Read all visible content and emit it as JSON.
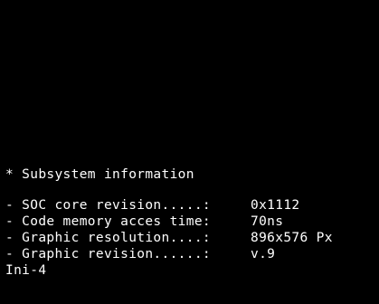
{
  "console": {
    "heading": "* Subsystem information",
    "info": [
      {
        "label": "- SOC core revision.....:",
        "value": "0x1112"
      },
      {
        "label": "- Code memory acces time:",
        "value": "70ns"
      },
      {
        "label": "- Graphic resolution....:",
        "value": "896x576 Px"
      },
      {
        "label": "- Graphic revision......:",
        "value": "v.9"
      }
    ],
    "status": "Ini-4"
  },
  "colors": {
    "background": "#000000",
    "text": "#ffffff"
  }
}
